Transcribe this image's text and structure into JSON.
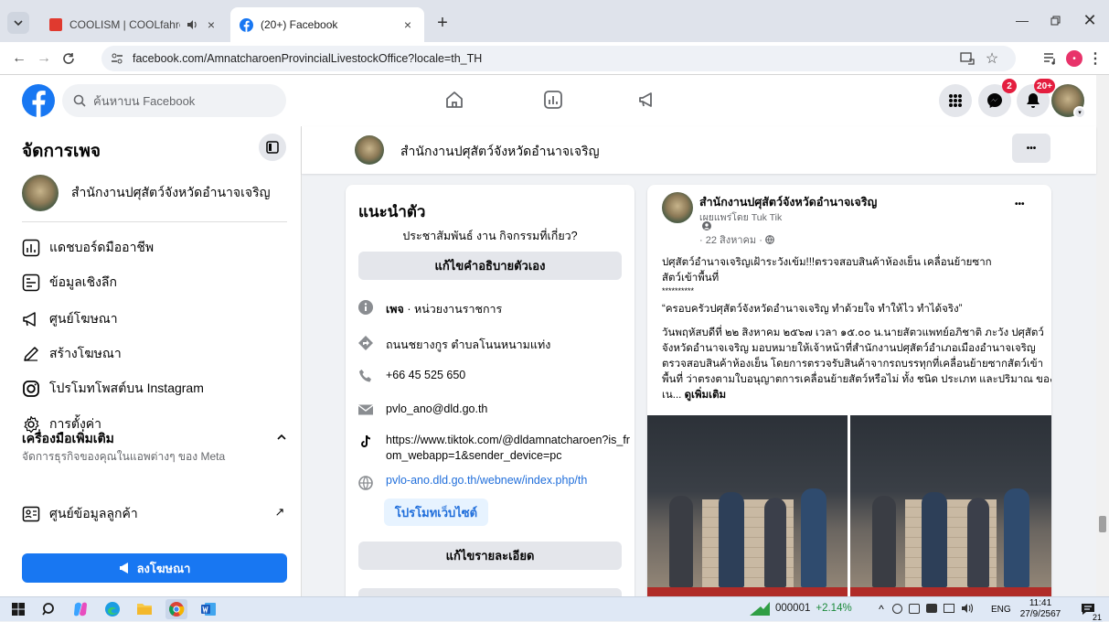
{
  "browser": {
    "tabs": [
      {
        "title": "COOLISM | COOLfahrenheit",
        "favicon_color": "#e03a2f",
        "audio": "speaker-icon",
        "active": false
      },
      {
        "title": "(20+) Facebook",
        "favicon_color": "#1877f2",
        "active": true
      }
    ],
    "url": "facebook.com/AmnatcharoenProvincialLivestockOffice?locale=th_TH",
    "profile_initial": "•"
  },
  "facebook": {
    "search_placeholder": "ค้นหาบน Facebook",
    "messenger_badge": "2",
    "notifications_badge": "20+"
  },
  "left": {
    "title": "จัดการเพจ",
    "page_name": "สำนักงานปศุสัตว์จังหวัดอำนาจเจริญ",
    "menu": [
      {
        "label": "แดชบอร์ดมืออาชีพ",
        "icon": "dashboard-icon"
      },
      {
        "label": "ข้อมูลเชิงลึก",
        "icon": "insights-icon"
      },
      {
        "label": "ศูนย์โฆษณา",
        "icon": "megaphone-icon"
      },
      {
        "label": "สร้างโฆษณา",
        "icon": "pencil-icon"
      },
      {
        "label": "โปรโมทโพสต์บน Instagram",
        "icon": "instagram-icon"
      },
      {
        "label": "การตั้งค่า",
        "icon": "gear-icon"
      }
    ],
    "more_tools_title": "เครื่องมือเพิ่มเติม",
    "more_tools_sub": "จัดการธุรกิจของคุณในแอพต่างๆ ของ Meta",
    "customer_center": "ศูนย์ข้อมูลลูกค้า",
    "ad_button": "ลงโฆษณา"
  },
  "pagebar": {
    "name": "สำนักงานปศุสัตว์จังหวัดอำนาจเจริญ",
    "more": "•••"
  },
  "intro": {
    "title": "แนะนำตัว",
    "prompt": "ประชาสัมพันธ์ งาน กิจกรรมที่เกี่ยว?",
    "edit_bio": "แก้ไขคำอธิบายตัวเอง",
    "category_bold": "เพจ",
    "category": " · หน่วยงานราชการ",
    "address": "ถนนชยางกูร ตำบลโนนหนามแท่ง",
    "phone": "+66 45 525 650",
    "email": "pvlo_ano@dld.go.th",
    "tiktok": "https://www.tiktok.com/@dldamnatcharoen?is_from_webapp=1&sender_device=pc",
    "website": "pvlo-ano.dld.go.th/webnew/index.php/th",
    "promote_site": "โปรโมทเว็บไซต์",
    "edit_details": "แก้ไขรายละเอียด"
  },
  "post": {
    "author": "สำนักงานปศุสัตว์จังหวัดอำนาจเจริญ",
    "published_by": "เผยแพร่โดย Tuk Tik",
    "date": "· 22 สิงหาคม ·",
    "more": "•••",
    "lines": [
      "ปศุสัตว์อำนาจเจริญเฝ้าระวังเข้ม!!!ตรวจสอบสินค้าห้องเย็น เคลื่อนย้ายซาก",
      "สัตว์เข้าพื้นที่",
      "**********",
      "“ครอบครัวปศุสัตว์จังหวัดอำนาจเจริญ ทำด้วยใจ ทำให้ไว ทำได้จริง”"
    ],
    "body": "วันพฤหัสบดีที่ ๒๒ สิงหาคม ๒๕๖๗ เวลา ๑๕.๐๐ น.นายสัตวแพทย์อภิชาติ ภะวัง ปศุสัตว์จังหวัดอำนาจเจริญ มอบหมายให้เจ้าหน้าที่สำนักงานปศุสัตว์อำเภอเมืองอำนาจเจริญ ตรวจสอบสินค้าห้องเย็น โดยการตรวจรับสินค้าจากรถบรรทุกที่เคลื่อนย้ายซากสัตว์เข้าพื้นที่ ว่าตรงตามใบอนุญาตการเคลื่อนย้ายสัตว์หรือไม่ ทั้ง ชนิด ประเภท และปริมาณ ของเน... ",
    "see_more": "ดูเพิ่มเติม"
  },
  "taskbar": {
    "stock_code": "000001",
    "stock_change": "+2.14%",
    "lang": "ENG",
    "time": "11:41",
    "date": "27/9/2567",
    "notif_count": "21"
  },
  "colors": {
    "fb_blue": "#1877f2",
    "link": "#216fdb",
    "green": "#31a24c"
  }
}
